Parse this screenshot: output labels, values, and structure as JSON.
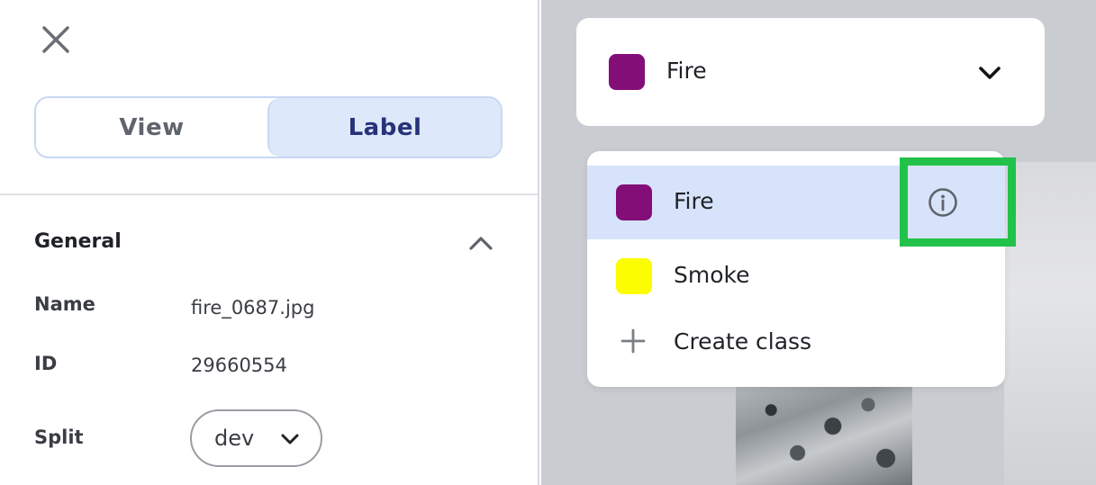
{
  "panel": {
    "tabs": {
      "view": "View",
      "label": "Label"
    },
    "general": {
      "title": "General",
      "name_label": "Name",
      "name_value": "fire_0687.jpg",
      "id_label": "ID",
      "id_value": "29660554",
      "split_label": "Split",
      "split_value": "dev"
    }
  },
  "class_selector": {
    "selected": "Fire",
    "selected_color": "#830e78"
  },
  "dropdown": {
    "items": [
      {
        "label": "Fire",
        "color": "#830e78",
        "selected": true
      },
      {
        "label": "Smoke",
        "color": "#fcfd00",
        "selected": false
      }
    ],
    "create_label": "Create class"
  },
  "icons": {
    "close": "close-icon",
    "collapse": "chevron-up-icon",
    "split_chevron": "chevron-down-icon",
    "class_chevron": "chevron-down-icon",
    "info": "info-icon",
    "plus": "plus-icon"
  },
  "colors": {
    "accent_highlight": "#22c24a",
    "tab_active_bg": "#dde8fb",
    "selected_row_bg": "#d6e3fa"
  }
}
